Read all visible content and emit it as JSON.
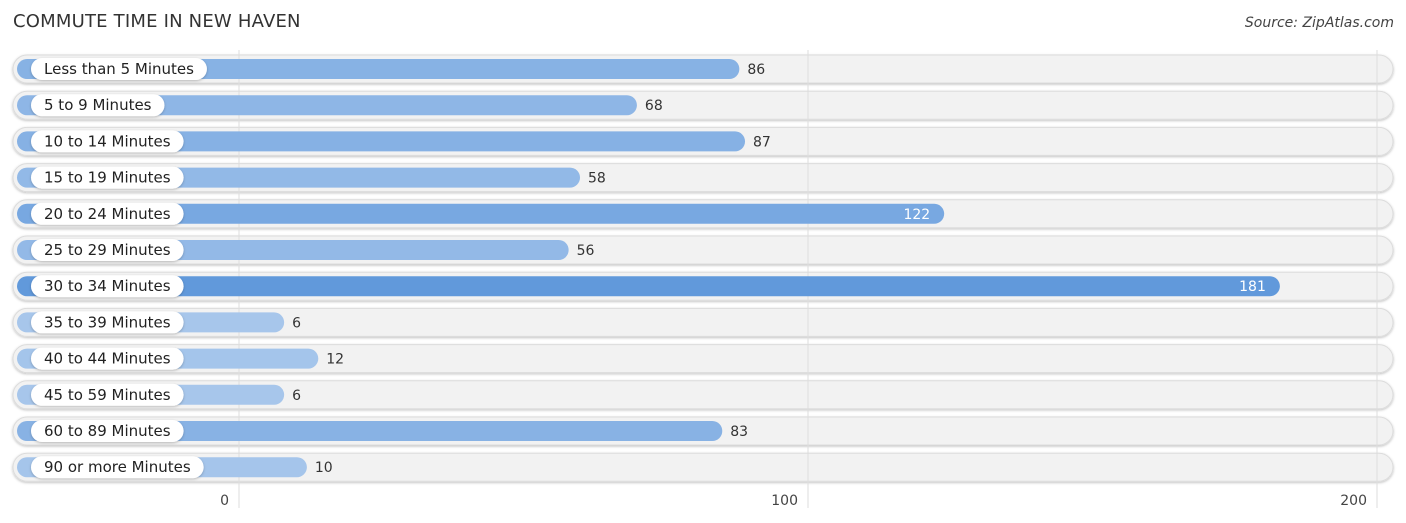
{
  "header": {
    "title": "COMMUTE TIME IN NEW HAVEN",
    "source": "Source: ZipAtlas.com"
  },
  "colors": {
    "bar_light": "#a9c8ec",
    "bar_dark": "#6199db",
    "track": "#f2f2f2",
    "grid": "#dddddd"
  },
  "chart_data": {
    "type": "bar",
    "orientation": "horizontal",
    "title": "COMMUTE TIME IN NEW HAVEN",
    "xlabel": "",
    "ylabel": "",
    "categories": [
      "Less than 5 Minutes",
      "5 to 9 Minutes",
      "10 to 14 Minutes",
      "15 to 19 Minutes",
      "20 to 24 Minutes",
      "25 to 29 Minutes",
      "30 to 34 Minutes",
      "35 to 39 Minutes",
      "40 to 44 Minutes",
      "45 to 59 Minutes",
      "60 to 89 Minutes",
      "90 or more Minutes"
    ],
    "values": [
      86,
      68,
      87,
      58,
      122,
      56,
      181,
      6,
      12,
      6,
      83,
      10
    ],
    "xlim": [
      0,
      200
    ],
    "xticks": [
      0,
      100,
      200
    ],
    "grid": true
  }
}
